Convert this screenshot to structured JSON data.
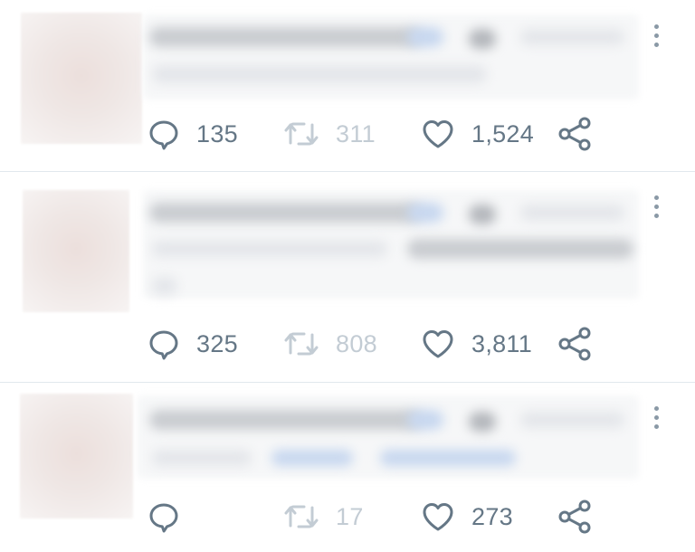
{
  "colors": {
    "icon": "#657786",
    "icon_muted": "#c3ccd4",
    "divider": "#e1e8ed",
    "more_dots": "#8a99a6"
  },
  "tweets": [
    {
      "replies": "135",
      "retweets": "311",
      "likes": "1,524"
    },
    {
      "replies": "325",
      "retweets": "808",
      "likes": "3,811"
    },
    {
      "replies": "",
      "retweets": "17",
      "likes": "273"
    }
  ],
  "icons": {
    "reply": "reply-icon",
    "retweet": "retweet-icon",
    "like": "heart-icon",
    "share": "share-icon",
    "more": "more-vertical-icon"
  }
}
